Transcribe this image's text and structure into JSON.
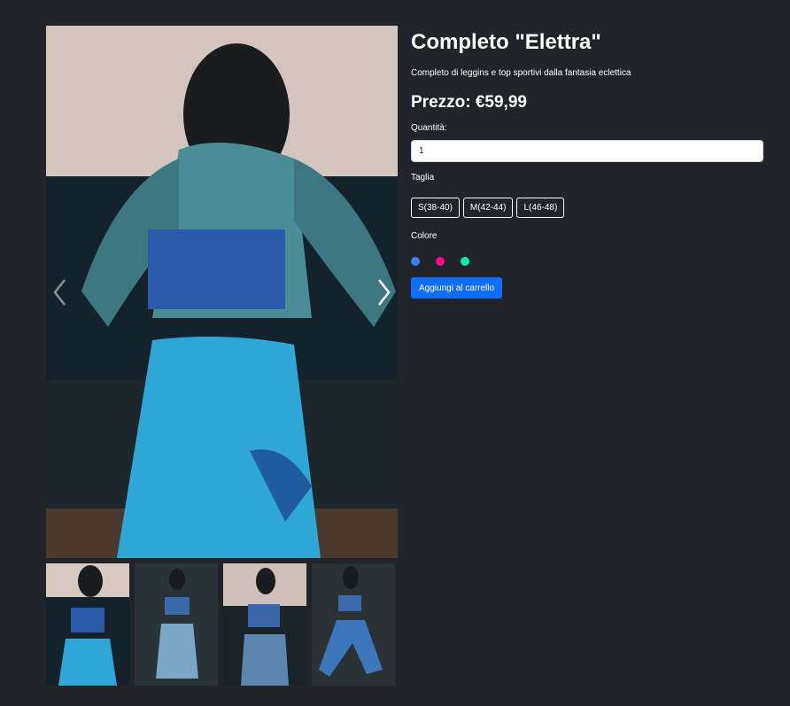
{
  "product": {
    "title": "Completo \"Elettra\"",
    "description": "Completo di leggins e top sportivi dalla fantasia eclettica",
    "price": "Prezzo: €59,99"
  },
  "quantity": {
    "label": "Quantità:",
    "value": "1"
  },
  "size": {
    "label": "Taglia",
    "options": [
      "S(38-40)",
      "M(42-44)",
      "L(46-48)"
    ]
  },
  "color": {
    "label": "Colore",
    "options": [
      "#3d7ef0",
      "#ff0a8f",
      "#00f0a8"
    ]
  },
  "cart_button": "Aggiungi al carrello",
  "icons": {
    "prev": "chevron-left-icon",
    "next": "chevron-right-icon"
  }
}
